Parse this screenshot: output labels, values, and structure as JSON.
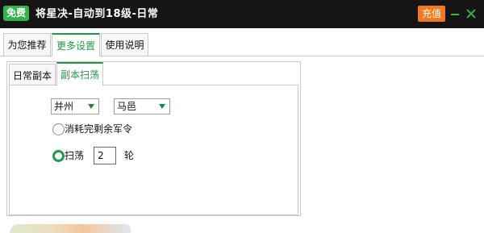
{
  "titlebar": {
    "badge": "免费",
    "title": "将星决-自动到18级-日常",
    "recharge_label": "充值",
    "accent_color": "#3fb14f"
  },
  "tabs": [
    {
      "label": "为您推荐",
      "active": false
    },
    {
      "label": "更多设置",
      "active": true
    },
    {
      "label": "使用说明",
      "active": false
    }
  ],
  "subtabs": [
    {
      "label": "日常副本",
      "active": false
    },
    {
      "label": "副本扫荡",
      "active": true
    }
  ],
  "sweep": {
    "region_select": "并州",
    "city_select": "马邑",
    "option_consume": "消耗完剩余军令",
    "option_sweep": "扫荡",
    "sweep_count": "2",
    "rounds_unit": "轮",
    "selected_option": "sweep"
  },
  "icons": {
    "minimize": "minimize-icon",
    "close": "close-icon",
    "dropdown": "chevron-down-icon"
  }
}
